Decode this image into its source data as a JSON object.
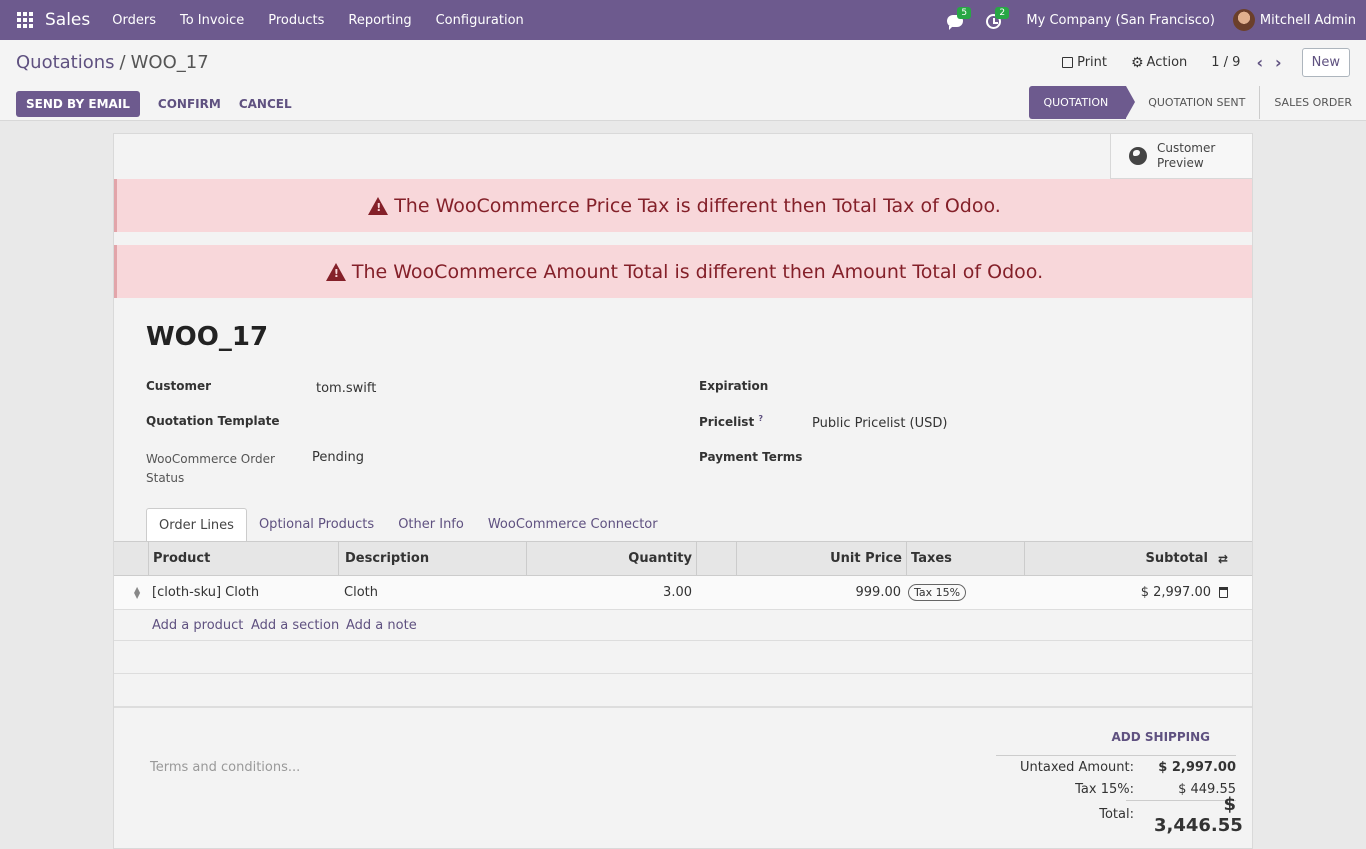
{
  "topbar": {
    "app_name": "Sales",
    "menu": [
      "Orders",
      "To Invoice",
      "Products",
      "Reporting",
      "Configuration"
    ],
    "messages_count": "5",
    "activities_count": "2",
    "company": "My Company (San Francisco)",
    "user": "Mitchell Admin"
  },
  "control_panel": {
    "breadcrumb_parent": "Quotations",
    "breadcrumb_sep": "/",
    "breadcrumb_current": "WOO_17",
    "print_label": "Print",
    "action_label": "Action",
    "pager": "1 / 9",
    "new_label": "New"
  },
  "buttons": {
    "send_email": "SEND BY EMAIL",
    "confirm": "CONFIRM",
    "cancel": "CANCEL"
  },
  "statusbar": [
    "QUOTATION",
    "QUOTATION SENT",
    "SALES ORDER"
  ],
  "customer_preview": "Customer Preview",
  "alerts": [
    "The WooCommerce Price Tax is different then Total Tax of Odoo.",
    "The WooCommerce Amount Total is different then Amount Total of Odoo."
  ],
  "record": {
    "name": "WOO_17",
    "customer_label": "Customer",
    "customer_value": "tom.swift",
    "template_label": "Quotation Template",
    "woo_status_label": "WooCommerce Order Status",
    "woo_status_value": "Pending",
    "expiration_label": "Expiration",
    "pricelist_label": "Pricelist",
    "pricelist_help": "?",
    "pricelist_value": "Public Pricelist (USD)",
    "payment_terms_label": "Payment Terms"
  },
  "tabs": [
    "Order Lines",
    "Optional Products",
    "Other Info",
    "WooCommerce Connector"
  ],
  "table": {
    "headers": {
      "product": "Product",
      "description": "Description",
      "quantity": "Quantity",
      "unit_price": "Unit Price",
      "taxes": "Taxes",
      "subtotal": "Subtotal"
    },
    "rows": [
      {
        "product": "[cloth-sku] Cloth",
        "description": "Cloth",
        "quantity": "3.00",
        "unit_price": "999.00",
        "tax": "Tax 15%",
        "subtotal": "$ 2,997.00"
      }
    ],
    "add_product": "Add a product",
    "add_section": "Add a section",
    "add_note": "Add a note"
  },
  "footer": {
    "terms_placeholder": "Terms and conditions...",
    "add_shipping": "ADD SHIPPING",
    "untaxed_label": "Untaxed Amount:",
    "untaxed_value": "$ 2,997.00",
    "tax_label": "Tax 15%:",
    "tax_value": "$ 449.55",
    "total_label": "Total:",
    "total_value": "$ 3,446.55"
  }
}
